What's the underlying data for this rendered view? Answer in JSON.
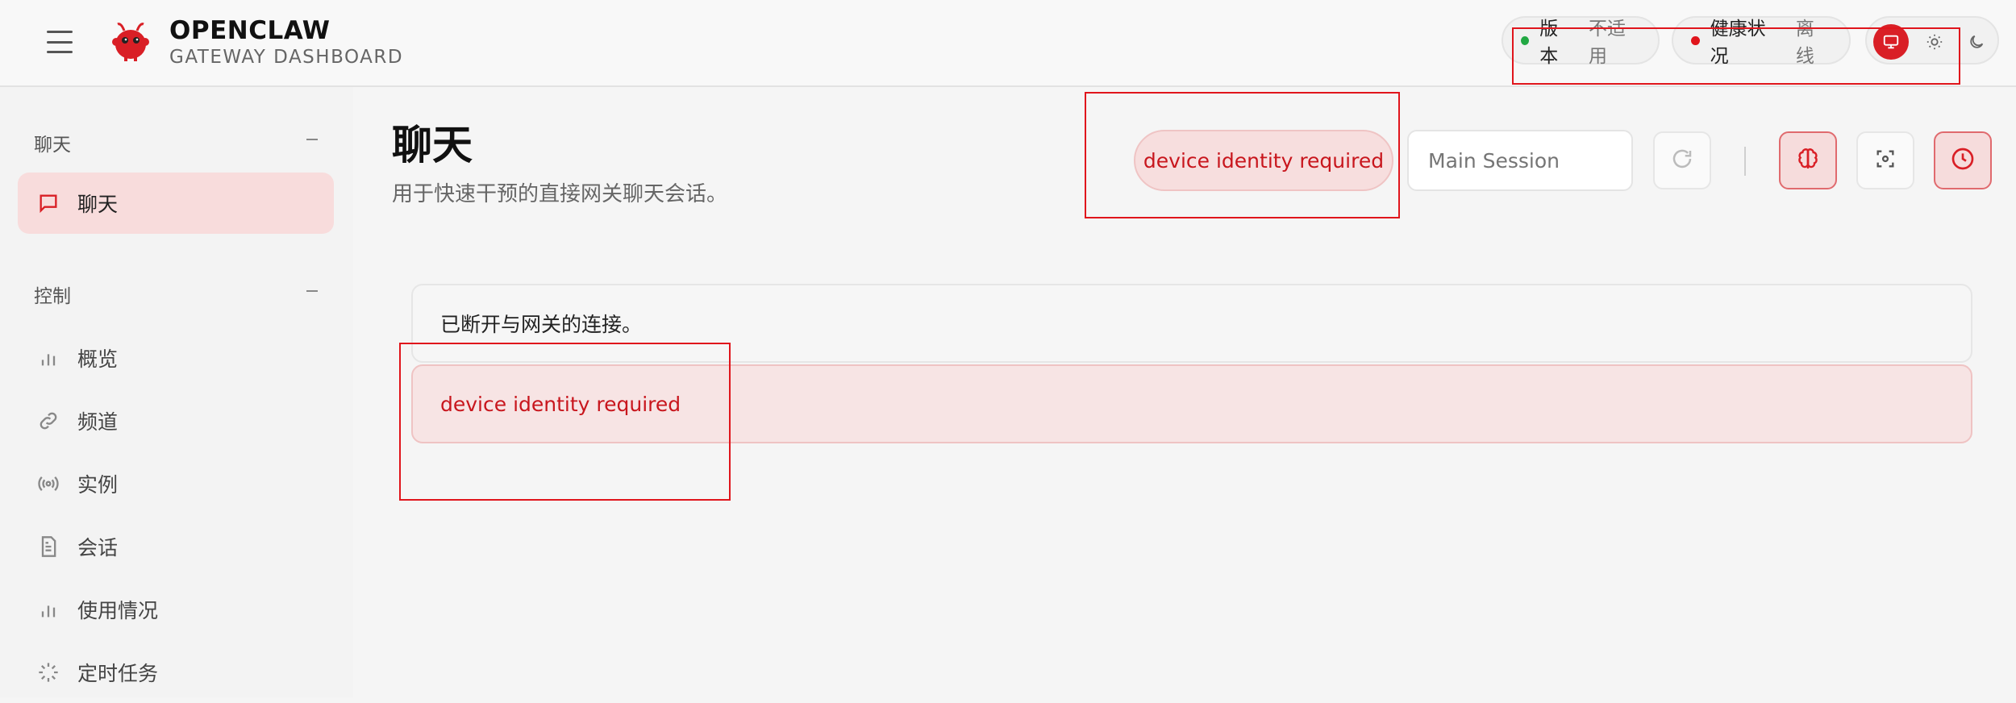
{
  "header": {
    "brand_title": "OPENCLAW",
    "brand_subtitle": "GATEWAY DASHBOARD",
    "version": {
      "label": "版本",
      "value": "不适用",
      "dot_color": "#22a843"
    },
    "health": {
      "label": "健康状况",
      "value": "离线",
      "dot_color": "#e0151c"
    },
    "theme_modes": [
      "monitor-icon",
      "sun-icon",
      "moon-icon"
    ]
  },
  "sidebar": {
    "sections": [
      {
        "title": "聊天",
        "items": [
          {
            "label": "聊天",
            "icon": "chat-icon",
            "active": true
          }
        ]
      },
      {
        "title": "控制",
        "items": [
          {
            "label": "概览",
            "icon": "bar-chart-icon"
          },
          {
            "label": "频道",
            "icon": "link-icon"
          },
          {
            "label": "实例",
            "icon": "radio-icon"
          },
          {
            "label": "会话",
            "icon": "document-icon"
          },
          {
            "label": "使用情况",
            "icon": "bar-chart-icon"
          },
          {
            "label": "定时任务",
            "icon": "loader-icon"
          }
        ]
      }
    ]
  },
  "main": {
    "title": "聊天",
    "subtitle": "用于快速干预的直接网关聊天会话。",
    "error_pill": "device identity required",
    "session_placeholder": "Main Session",
    "toolbar_icons": [
      "refresh-icon",
      "brain-icon",
      "focus-icon",
      "clock-icon"
    ],
    "messages": [
      {
        "text": "已断开与网关的连接。",
        "type": "info"
      },
      {
        "text": "device identity required",
        "type": "error"
      }
    ]
  },
  "colors": {
    "accent": "#d91f26",
    "error_text": "#c8161d",
    "error_bg": "#f7e4e4"
  }
}
